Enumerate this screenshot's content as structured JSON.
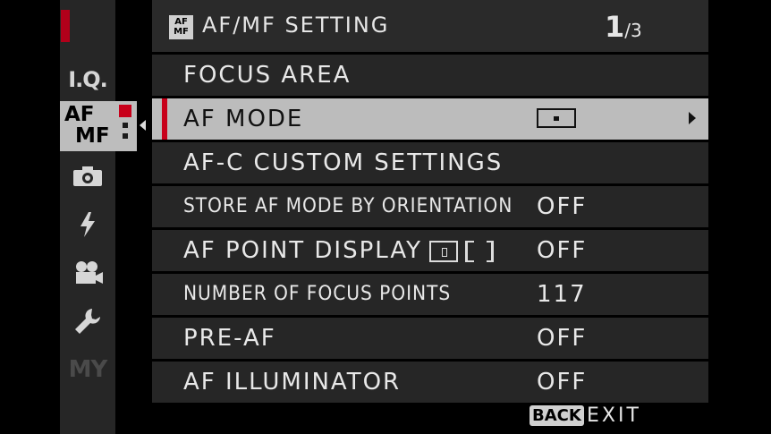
{
  "header": {
    "badge_line1": "AF",
    "badge_line2": "MF",
    "title": "AF/MF SETTING",
    "page_current": "1",
    "page_total": "/3"
  },
  "sidebar": {
    "items": [
      {
        "name": "iq",
        "label": "I.Q."
      },
      {
        "name": "af-mf",
        "label_line1": "AF",
        "label_line2": "MF",
        "active": true
      },
      {
        "name": "camera",
        "icon": "camera-icon"
      },
      {
        "name": "flash",
        "icon": "flash-icon"
      },
      {
        "name": "movie",
        "icon": "movie-camera-icon"
      },
      {
        "name": "setup",
        "icon": "wrench-icon"
      },
      {
        "name": "my-menu",
        "label": "MY"
      }
    ]
  },
  "menu": {
    "rows": [
      {
        "label": "FOCUS AREA",
        "value": ""
      },
      {
        "label": "AF MODE",
        "value": "",
        "value_icon": "single-point-af-icon",
        "selected": true
      },
      {
        "label": "AF-C CUSTOM SETTINGS",
        "value": ""
      },
      {
        "label": "STORE AF MODE BY ORIENTATION",
        "value": "OFF"
      },
      {
        "label": "AF POINT DISPLAY",
        "value": "OFF"
      },
      {
        "label": "NUMBER OF FOCUS POINTS",
        "value": "117"
      },
      {
        "label": "PRE-AF",
        "value": "OFF"
      },
      {
        "label": "AF ILLUMINATOR",
        "value": "OFF"
      }
    ]
  },
  "footer": {
    "back_label": "BACK",
    "exit_label": "EXIT"
  },
  "colors": {
    "accent_red": "#c8001a",
    "row_bg": "#262626",
    "selected_bg": "#bcbcbc"
  }
}
